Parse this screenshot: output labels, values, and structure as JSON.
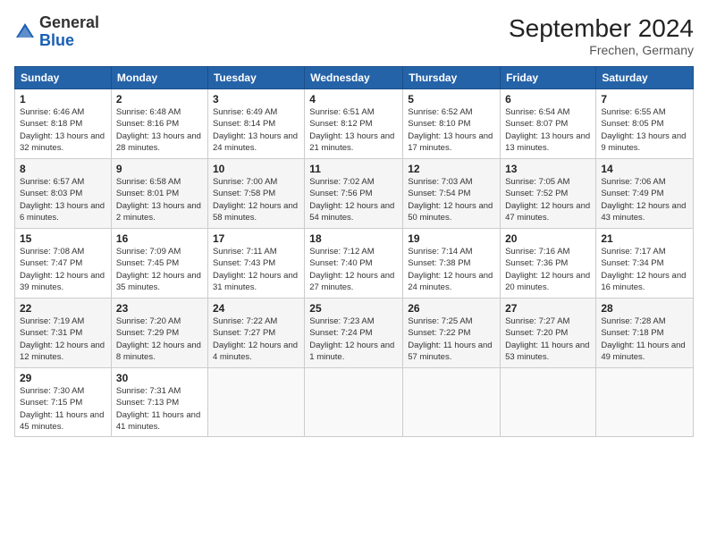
{
  "header": {
    "logo_general": "General",
    "logo_blue": "Blue",
    "month_title": "September 2024",
    "location": "Frechen, Germany"
  },
  "columns": [
    "Sunday",
    "Monday",
    "Tuesday",
    "Wednesday",
    "Thursday",
    "Friday",
    "Saturday"
  ],
  "weeks": [
    [
      {
        "day": "1",
        "sunrise": "Sunrise: 6:46 AM",
        "sunset": "Sunset: 8:18 PM",
        "daylight": "Daylight: 13 hours and 32 minutes."
      },
      {
        "day": "2",
        "sunrise": "Sunrise: 6:48 AM",
        "sunset": "Sunset: 8:16 PM",
        "daylight": "Daylight: 13 hours and 28 minutes."
      },
      {
        "day": "3",
        "sunrise": "Sunrise: 6:49 AM",
        "sunset": "Sunset: 8:14 PM",
        "daylight": "Daylight: 13 hours and 24 minutes."
      },
      {
        "day": "4",
        "sunrise": "Sunrise: 6:51 AM",
        "sunset": "Sunset: 8:12 PM",
        "daylight": "Daylight: 13 hours and 21 minutes."
      },
      {
        "day": "5",
        "sunrise": "Sunrise: 6:52 AM",
        "sunset": "Sunset: 8:10 PM",
        "daylight": "Daylight: 13 hours and 17 minutes."
      },
      {
        "day": "6",
        "sunrise": "Sunrise: 6:54 AM",
        "sunset": "Sunset: 8:07 PM",
        "daylight": "Daylight: 13 hours and 13 minutes."
      },
      {
        "day": "7",
        "sunrise": "Sunrise: 6:55 AM",
        "sunset": "Sunset: 8:05 PM",
        "daylight": "Daylight: 13 hours and 9 minutes."
      }
    ],
    [
      {
        "day": "8",
        "sunrise": "Sunrise: 6:57 AM",
        "sunset": "Sunset: 8:03 PM",
        "daylight": "Daylight: 13 hours and 6 minutes."
      },
      {
        "day": "9",
        "sunrise": "Sunrise: 6:58 AM",
        "sunset": "Sunset: 8:01 PM",
        "daylight": "Daylight: 13 hours and 2 minutes."
      },
      {
        "day": "10",
        "sunrise": "Sunrise: 7:00 AM",
        "sunset": "Sunset: 7:58 PM",
        "daylight": "Daylight: 12 hours and 58 minutes."
      },
      {
        "day": "11",
        "sunrise": "Sunrise: 7:02 AM",
        "sunset": "Sunset: 7:56 PM",
        "daylight": "Daylight: 12 hours and 54 minutes."
      },
      {
        "day": "12",
        "sunrise": "Sunrise: 7:03 AM",
        "sunset": "Sunset: 7:54 PM",
        "daylight": "Daylight: 12 hours and 50 minutes."
      },
      {
        "day": "13",
        "sunrise": "Sunrise: 7:05 AM",
        "sunset": "Sunset: 7:52 PM",
        "daylight": "Daylight: 12 hours and 47 minutes."
      },
      {
        "day": "14",
        "sunrise": "Sunrise: 7:06 AM",
        "sunset": "Sunset: 7:49 PM",
        "daylight": "Daylight: 12 hours and 43 minutes."
      }
    ],
    [
      {
        "day": "15",
        "sunrise": "Sunrise: 7:08 AM",
        "sunset": "Sunset: 7:47 PM",
        "daylight": "Daylight: 12 hours and 39 minutes."
      },
      {
        "day": "16",
        "sunrise": "Sunrise: 7:09 AM",
        "sunset": "Sunset: 7:45 PM",
        "daylight": "Daylight: 12 hours and 35 minutes."
      },
      {
        "day": "17",
        "sunrise": "Sunrise: 7:11 AM",
        "sunset": "Sunset: 7:43 PM",
        "daylight": "Daylight: 12 hours and 31 minutes."
      },
      {
        "day": "18",
        "sunrise": "Sunrise: 7:12 AM",
        "sunset": "Sunset: 7:40 PM",
        "daylight": "Daylight: 12 hours and 27 minutes."
      },
      {
        "day": "19",
        "sunrise": "Sunrise: 7:14 AM",
        "sunset": "Sunset: 7:38 PM",
        "daylight": "Daylight: 12 hours and 24 minutes."
      },
      {
        "day": "20",
        "sunrise": "Sunrise: 7:16 AM",
        "sunset": "Sunset: 7:36 PM",
        "daylight": "Daylight: 12 hours and 20 minutes."
      },
      {
        "day": "21",
        "sunrise": "Sunrise: 7:17 AM",
        "sunset": "Sunset: 7:34 PM",
        "daylight": "Daylight: 12 hours and 16 minutes."
      }
    ],
    [
      {
        "day": "22",
        "sunrise": "Sunrise: 7:19 AM",
        "sunset": "Sunset: 7:31 PM",
        "daylight": "Daylight: 12 hours and 12 minutes."
      },
      {
        "day": "23",
        "sunrise": "Sunrise: 7:20 AM",
        "sunset": "Sunset: 7:29 PM",
        "daylight": "Daylight: 12 hours and 8 minutes."
      },
      {
        "day": "24",
        "sunrise": "Sunrise: 7:22 AM",
        "sunset": "Sunset: 7:27 PM",
        "daylight": "Daylight: 12 hours and 4 minutes."
      },
      {
        "day": "25",
        "sunrise": "Sunrise: 7:23 AM",
        "sunset": "Sunset: 7:24 PM",
        "daylight": "Daylight: 12 hours and 1 minute."
      },
      {
        "day": "26",
        "sunrise": "Sunrise: 7:25 AM",
        "sunset": "Sunset: 7:22 PM",
        "daylight": "Daylight: 11 hours and 57 minutes."
      },
      {
        "day": "27",
        "sunrise": "Sunrise: 7:27 AM",
        "sunset": "Sunset: 7:20 PM",
        "daylight": "Daylight: 11 hours and 53 minutes."
      },
      {
        "day": "28",
        "sunrise": "Sunrise: 7:28 AM",
        "sunset": "Sunset: 7:18 PM",
        "daylight": "Daylight: 11 hours and 49 minutes."
      }
    ],
    [
      {
        "day": "29",
        "sunrise": "Sunrise: 7:30 AM",
        "sunset": "Sunset: 7:15 PM",
        "daylight": "Daylight: 11 hours and 45 minutes."
      },
      {
        "day": "30",
        "sunrise": "Sunrise: 7:31 AM",
        "sunset": "Sunset: 7:13 PM",
        "daylight": "Daylight: 11 hours and 41 minutes."
      },
      null,
      null,
      null,
      null,
      null
    ]
  ]
}
